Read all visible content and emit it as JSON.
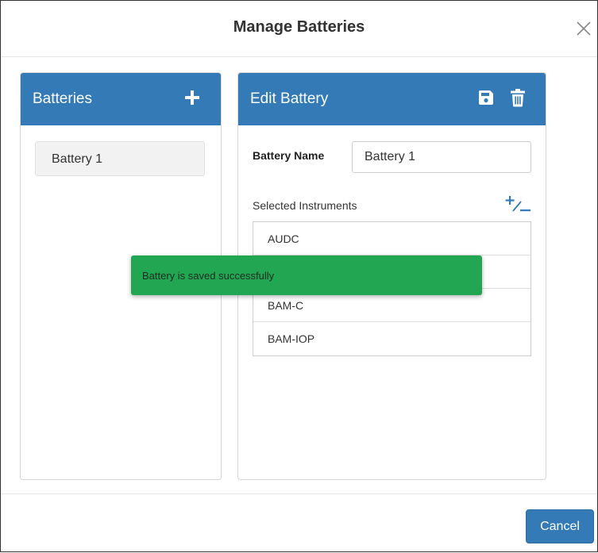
{
  "modal": {
    "title": "Manage Batteries",
    "close_icon": "close-icon"
  },
  "batteries_panel": {
    "title": "Batteries",
    "add_icon": "plus-icon",
    "items": [
      {
        "label": "Battery 1"
      }
    ]
  },
  "edit_panel": {
    "title": "Edit Battery",
    "save_icon": "floppy-disk-icon",
    "delete_icon": "trash-icon",
    "battery_name_label": "Battery Name",
    "battery_name_value": "Battery 1",
    "selected_instruments_label": "Selected Instruments",
    "add_remove_icon": "plus-minus-icon",
    "instruments": [
      {
        "label": "AUDC"
      },
      {
        "label": ""
      },
      {
        "label": "BAM-C"
      },
      {
        "label": "BAM-IOP"
      }
    ]
  },
  "toast": {
    "message": "Battery is saved successfully"
  },
  "footer": {
    "cancel_label": "Cancel"
  },
  "colors": {
    "primary": "#337ab7",
    "success_toast": "#22a651",
    "panel_border": "#d6d6d6"
  }
}
